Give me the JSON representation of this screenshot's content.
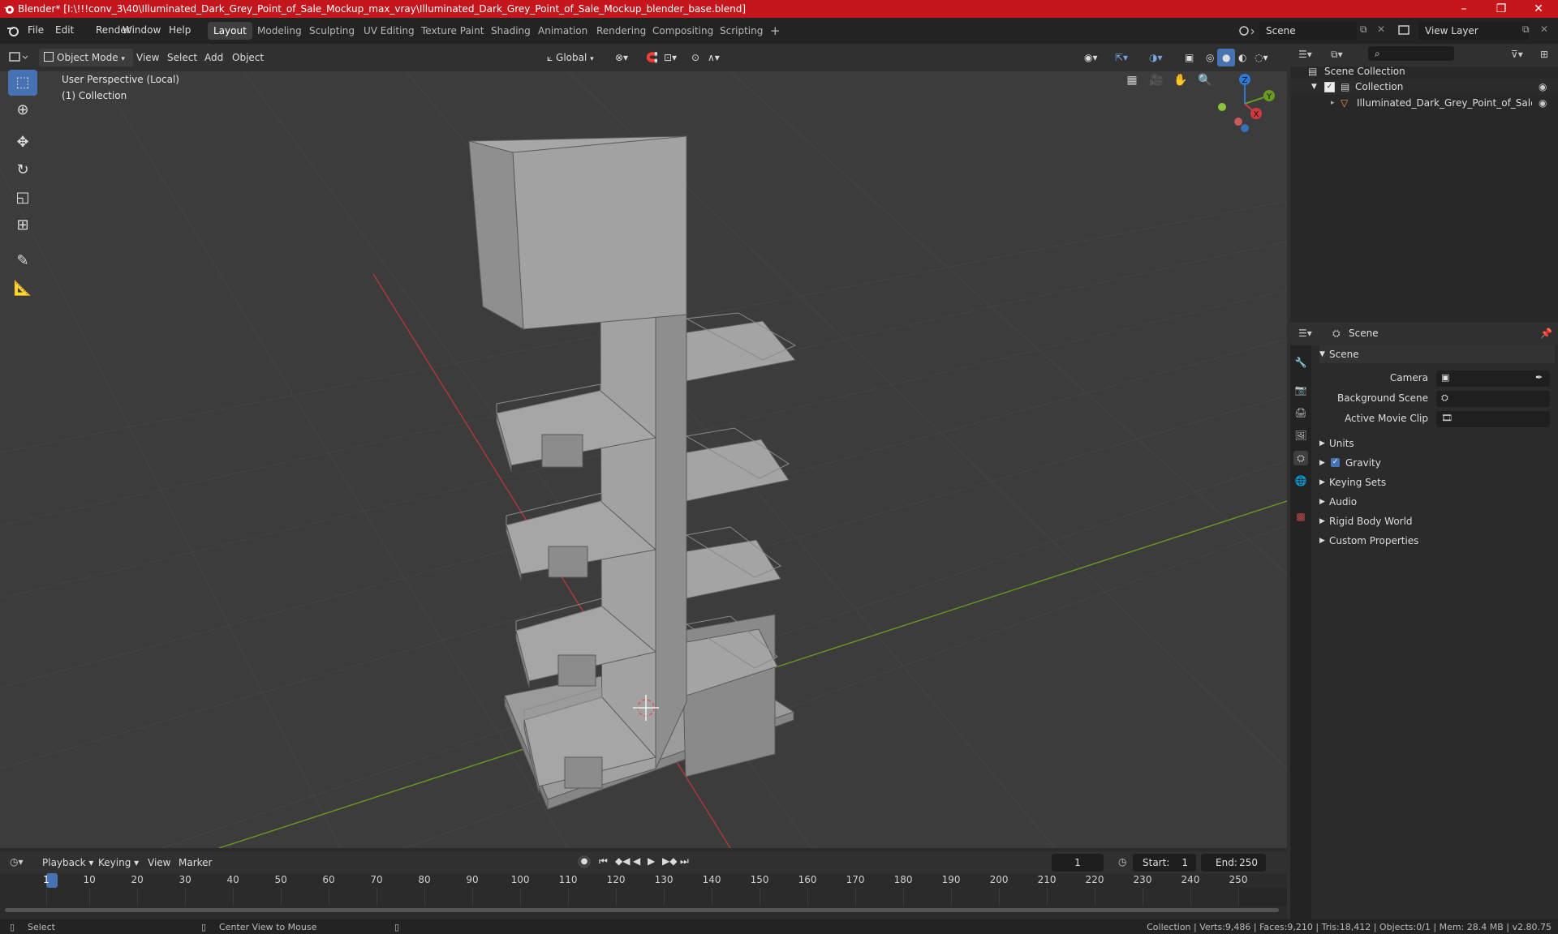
{
  "window": {
    "title": "Blender* [I:\\!!!conv_3\\40\\Illuminated_Dark_Grey_Point_of_Sale_Mockup_max_vray\\Illuminated_Dark_Grey_Point_of_Sale_Mockup_blender_base.blend]",
    "minimize": "–",
    "maximize": "❐",
    "close": "✕"
  },
  "menu": {
    "items": [
      "File",
      "Edit",
      "Render",
      "Window",
      "Help"
    ]
  },
  "workspaces": {
    "tabs": [
      "Layout",
      "Modeling",
      "Sculpting",
      "UV Editing",
      "Texture Paint",
      "Shading",
      "Animation",
      "Rendering",
      "Compositing",
      "Scripting"
    ],
    "active": "Layout",
    "add": "+"
  },
  "scene_selector": {
    "value": "Scene"
  },
  "view_layer": {
    "value": "View Layer"
  },
  "viewport_header": {
    "mode": "Object Mode",
    "menus": [
      "View",
      "Select",
      "Add",
      "Object"
    ],
    "transform_orientation": "Global"
  },
  "viewport": {
    "perspective": "User Perspective (Local)",
    "collection": "(1) Collection",
    "gizmo": {
      "x": "X",
      "y": "Y",
      "z": "Z"
    }
  },
  "outliner": {
    "search_placeholder": "",
    "root": "Scene Collection",
    "collection": "Collection",
    "object": "Illuminated_Dark_Grey_Point_of_Sale_Mockup"
  },
  "properties": {
    "context": "Scene",
    "panel_title": "Scene",
    "fields": [
      {
        "label": "Camera",
        "value": ""
      },
      {
        "label": "Background Scene",
        "value": ""
      },
      {
        "label": "Active Movie Clip",
        "value": ""
      }
    ],
    "sections": [
      "Units",
      "Gravity",
      "Keying Sets",
      "Audio",
      "Rigid Body World",
      "Custom Properties"
    ],
    "gravity_checked": true
  },
  "timeline": {
    "menus": [
      "Playback",
      "Keying",
      "View",
      "Marker"
    ],
    "current_frame": "1",
    "start_label": "Start:",
    "start": "1",
    "end_label": "End:",
    "end": "250",
    "ticks": [
      "1",
      "10",
      "20",
      "30",
      "40",
      "50",
      "60",
      "70",
      "80",
      "90",
      "100",
      "110",
      "120",
      "130",
      "140",
      "150",
      "160",
      "170",
      "180",
      "190",
      "200",
      "210",
      "220",
      "230",
      "240",
      "250"
    ]
  },
  "status": {
    "select": "Select",
    "center": "Center View to Mouse",
    "stats": "Collection | Verts:9,486 | Faces:9,210 | Tris:18,412 | Objects:0/1 | Mem: 28.4 MB | v2.80.75"
  },
  "colors": {
    "title_bar": "#c4161c",
    "accent": "#4772b3",
    "x_axis": "#d0393e",
    "y_axis": "#6a9a1f",
    "z_axis": "#2e78d6"
  }
}
